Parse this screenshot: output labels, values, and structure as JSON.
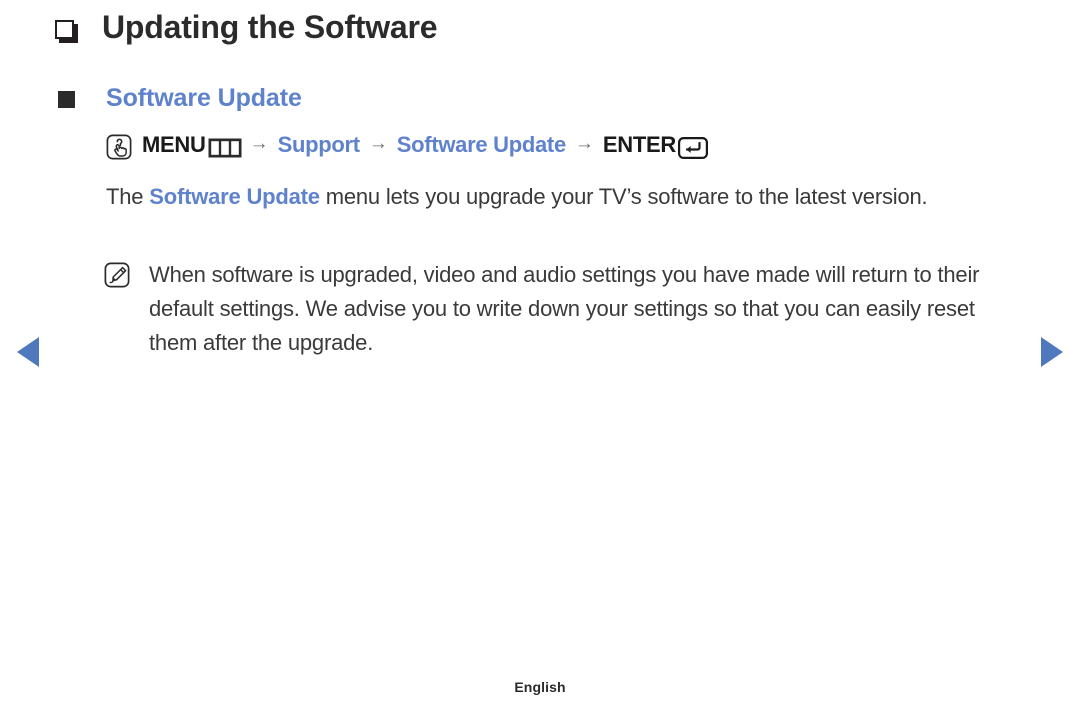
{
  "page": {
    "chapter_title": "Updating the Software",
    "section_heading": "Software Update",
    "footer_language": "English"
  },
  "menu_path": {
    "press_icon": "press-button-icon",
    "menu_label": "MENU",
    "menu_icon": "menu-bars-icon",
    "arrow": "→",
    "step_support": "Support",
    "step_software_update": "Software Update",
    "enter_label": "ENTER",
    "enter_icon": "enter-return-key-icon"
  },
  "body": {
    "para_before": "The ",
    "para_highlight": "Software Update",
    "para_after": " menu lets you upgrade your TV’s software to the latest version."
  },
  "note": {
    "icon": "note-pencil-icon",
    "text": "When software is upgraded, video and audio settings you have made will return to their default settings. We advise you to write down your settings so that you can easily reset them after the upgrade."
  },
  "navigation": {
    "prev_label": "previous-page-arrow",
    "next_label": "next-page-arrow"
  },
  "colors": {
    "accent_blue": "#5e82cb",
    "arrow_blue": "#5078bd",
    "text_dark": "#2b2b2b"
  }
}
